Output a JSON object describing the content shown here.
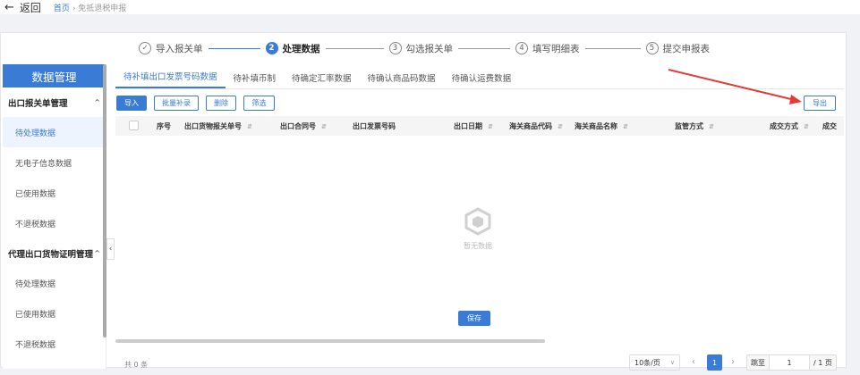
{
  "topbar": {
    "back_label": "返回",
    "breadcrumb_home": "首页",
    "breadcrumb_sep": "›",
    "breadcrumb_current": "免抵退税申报"
  },
  "steps": [
    {
      "num": "✓",
      "label": "导入报关单",
      "state": "done"
    },
    {
      "num": "2",
      "label": "处理数据",
      "state": "active"
    },
    {
      "num": "3",
      "label": "勾选报关单",
      "state": "todo"
    },
    {
      "num": "4",
      "label": "填写明细表",
      "state": "todo"
    },
    {
      "num": "5",
      "label": "提交申报表",
      "state": "todo"
    }
  ],
  "sidebar": {
    "title": "数据管理",
    "group1": {
      "label": "出口报关单管理",
      "chev": "^"
    },
    "group1_items": [
      "待处理数据",
      "无电子信息数据",
      "已使用数据",
      "不退税数据"
    ],
    "group2": {
      "label": "代理出口货物证明管理",
      "chev": "^"
    },
    "group2_items": [
      "待处理数据",
      "已使用数据",
      "不退税数据"
    ],
    "collapse": "‹"
  },
  "tabs": [
    "待补填出口发票号码数据",
    "待补填币制",
    "待确定汇率数据",
    "待确认商品码数据",
    "待确认运费数据"
  ],
  "toolbar": {
    "import": "导入",
    "batch_fill": "批量补录",
    "delete": "删除",
    "filter": "筛选",
    "export": "导出"
  },
  "table": {
    "headers": [
      "序号",
      "出口货物报关单号",
      "出口合同号",
      "出口发票号码",
      "出口日期",
      "海关商品代码",
      "海关商品名称",
      "监管方式",
      "成交方式",
      "成交"
    ],
    "empty_text": "暂无数据"
  },
  "footer": {
    "total": "共 0 条",
    "page_size": "10条/页",
    "prev": "‹",
    "current_page": "1",
    "next": "›",
    "goto_label": "跳至",
    "goto_value": "1",
    "total_pages": "/ 1 页"
  },
  "save_label": "保存",
  "colors": {
    "accent": "#3a7bd5",
    "annotation_arrow": "#e53935"
  }
}
